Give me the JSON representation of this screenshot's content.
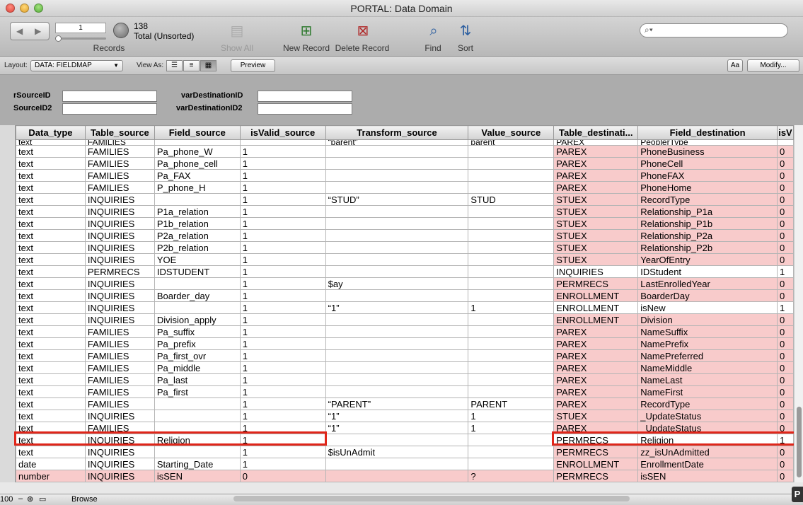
{
  "window": {
    "title": "PORTAL: Data Domain"
  },
  "toolbar": {
    "record_value": "1",
    "found_count": "138",
    "sort_status": "Total (Unsorted)",
    "records_label": "Records",
    "show_all_label": "Show All",
    "new_record_label": "New Record",
    "delete_record_label": "Delete Record",
    "find_label": "Find",
    "sort_label": "Sort",
    "search_placeholder": ""
  },
  "layout_bar": {
    "layout_label": "Layout:",
    "layout_value": "DATA: FIELDMAP",
    "view_as_label": "View As:",
    "preview_label": "Preview",
    "text_size_label": "Aa",
    "modify_label": "Modify..."
  },
  "header_fields": {
    "var_source_id_label": "rSourceID",
    "var_source_id2_label": "SourceID2",
    "var_dest_id_label": "varDestinationID",
    "var_dest_id2_label": "varDestinationID2"
  },
  "grid": {
    "columns": [
      "Data_type",
      "Table_source",
      "Field_source",
      "isValid_source",
      "Transform_source",
      "Value_source",
      "Table_destinati...",
      "Field_destination",
      "isV"
    ],
    "partial_top_row": [
      "text",
      "FAMILIES",
      "",
      "",
      "“parent”",
      "parent",
      "PAREX",
      "PeoplerType",
      ""
    ],
    "rows": [
      [
        "text",
        "FAMILIES",
        "Pa_phone_W",
        "1",
        "",
        "",
        "PAREX",
        "PhoneBusiness",
        "0"
      ],
      [
        "text",
        "FAMILIES",
        "Pa_phone_cell",
        "1",
        "",
        "",
        "PAREX",
        "PhoneCell",
        "0"
      ],
      [
        "text",
        "FAMILIES",
        "Pa_FAX",
        "1",
        "",
        "",
        "PAREX",
        "PhoneFAX",
        "0"
      ],
      [
        "text",
        "FAMILIES",
        "P_phone_H",
        "1",
        "",
        "",
        "PAREX",
        "PhoneHome",
        "0"
      ],
      [
        "text",
        "INQUIRIES",
        "",
        "1",
        "“STUD”",
        "STUD",
        "STUEX",
        "RecordType",
        "0"
      ],
      [
        "text",
        "INQUIRIES",
        "P1a_relation",
        "1",
        "",
        "",
        "STUEX",
        "Relationship_P1a",
        "0"
      ],
      [
        "text",
        "INQUIRIES",
        "P1b_relation",
        "1",
        "",
        "",
        "STUEX",
        "Relationship_P1b",
        "0"
      ],
      [
        "text",
        "INQUIRIES",
        "P2a_relation",
        "1",
        "",
        "",
        "STUEX",
        "Relationship_P2a",
        "0"
      ],
      [
        "text",
        "INQUIRIES",
        "P2b_relation",
        "1",
        "",
        "",
        "STUEX",
        "Relationship_P2b",
        "0"
      ],
      [
        "text",
        "INQUIRIES",
        "YOE",
        "1",
        "",
        "",
        "STUEX",
        "YearOfEntry",
        "0"
      ],
      [
        "text",
        "PERMRECS",
        "IDSTUDENT",
        "1",
        "",
        "",
        "INQUIRIES",
        "IDStudent",
        "1"
      ],
      [
        "text",
        "INQUIRIES",
        "",
        "1",
        "$ay",
        "",
        "PERMRECS",
        "LastEnrolledYear",
        "0"
      ],
      [
        "text",
        "INQUIRIES",
        "Boarder_day",
        "1",
        "",
        "",
        "ENROLLMENT",
        "BoarderDay",
        "0"
      ],
      [
        "text",
        "INQUIRIES",
        "",
        "1",
        "“1”",
        "1",
        "ENROLLMENT",
        "isNew",
        "1"
      ],
      [
        "text",
        "INQUIRIES",
        "Division_apply",
        "1",
        "",
        "",
        "ENROLLMENT",
        "Division",
        "0"
      ],
      [
        "text",
        "FAMILIES",
        "Pa_suffix",
        "1",
        "",
        "",
        "PAREX",
        "NameSuffix",
        "0"
      ],
      [
        "text",
        "FAMILIES",
        "Pa_prefix",
        "1",
        "",
        "",
        "PAREX",
        "NamePrefix",
        "0"
      ],
      [
        "text",
        "FAMILIES",
        "Pa_first_ovr",
        "1",
        "",
        "",
        "PAREX",
        "NamePreferred",
        "0"
      ],
      [
        "text",
        "FAMILIES",
        "Pa_middle",
        "1",
        "",
        "",
        "PAREX",
        "NameMiddle",
        "0"
      ],
      [
        "text",
        "FAMILIES",
        "Pa_last",
        "1",
        "",
        "",
        "PAREX",
        "NameLast",
        "0"
      ],
      [
        "text",
        "FAMILIES",
        "Pa_first",
        "1",
        "",
        "",
        "PAREX",
        "NameFirst",
        "0"
      ],
      [
        "text",
        "FAMILIES",
        "",
        "1",
        "“PARENT”",
        "PARENT",
        "PAREX",
        "RecordType",
        "0"
      ],
      [
        "text",
        "INQUIRIES",
        "",
        "1",
        "“1”",
        "1",
        "STUEX",
        "_UpdateStatus",
        "0"
      ],
      [
        "text",
        "FAMILIES",
        "",
        "1",
        "“1”",
        "1",
        "PAREX",
        "_UpdateStatus",
        "0"
      ],
      [
        "text",
        "INQUIRIES",
        "Religion",
        "1",
        "",
        "",
        "PERMRECS",
        "Religion",
        "1"
      ],
      [
        "text",
        "INQUIRIES",
        "",
        "1",
        "$isUnAdmit",
        "",
        "PERMRECS",
        "zz_isUnAdmitted",
        "0"
      ],
      [
        "date",
        "INQUIRIES",
        "Starting_Date",
        "1",
        "",
        "",
        "ENROLLMENT",
        "EnrollmentDate",
        "0"
      ],
      [
        "number",
        "INQUIRIES",
        "isSEN",
        "0",
        "",
        "?",
        "PERMRECS",
        "isSEN",
        "0"
      ]
    ]
  },
  "status_bar": {
    "zoom": "100",
    "mode": "Browse"
  },
  "colors": {
    "highlight_row": "#e0261a",
    "invalid_cell": "#f8cbcb"
  }
}
